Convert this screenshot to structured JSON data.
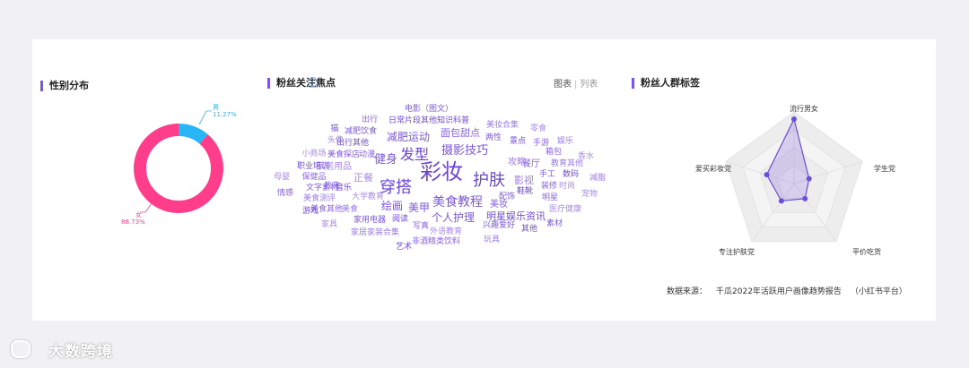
{
  "watermark": {
    "text": "大数跨境"
  },
  "sections": {
    "gender": "性别分布",
    "focus": "粉丝关注焦点",
    "tags": "粉丝人群标签"
  },
  "tabs": {
    "graph": "图表",
    "list": "列表"
  },
  "source": {
    "label": "数据来源：",
    "report": "千瓜2022年活跃用户画像趋势报告",
    "platform": "（小红书平台）"
  },
  "colors": {
    "male": "#29b6f6",
    "female": "#ff3d8b",
    "accent": "#7b55ea",
    "radar": "#6a4fd8"
  },
  "chart_data": [
    {
      "type": "pie",
      "title": "性别分布",
      "slices": [
        {
          "name": "男",
          "value": 11.27,
          "label": "11.27%"
        },
        {
          "name": "女",
          "value": 88.73,
          "label": "88.73%"
        }
      ]
    },
    {
      "type": "wordcloud",
      "title": "粉丝关注焦点",
      "words": [
        "彩妆",
        "护肤",
        "穿搭",
        "发型",
        "美食教程",
        "摄影技巧",
        "减肥运动",
        "健身",
        "美甲",
        "个人护理",
        "绘画",
        "面包甜点",
        "影视",
        "正餐",
        "美妆",
        "明星娱乐资讯",
        "餐厅",
        "攻略",
        "家居用品",
        "电影（图文）",
        "日常片段其他知识科普",
        "出行",
        "美妆合集",
        "零食",
        "两性",
        "景点",
        "手游",
        "娱乐",
        "香水",
        "减肥饮食",
        "出行其他",
        "动漫",
        "头像",
        "小商场",
        "美食探店",
        "职业培训",
        "保健品",
        "教育",
        "母婴",
        "文字素材",
        "音乐",
        "情感",
        "美食测评",
        "大学教育",
        "配饰",
        "游戏",
        "美食其他",
        "美食",
        "家具",
        "家用电器",
        "阅读",
        "写真",
        "家居家装合集",
        "外语教育",
        "兴趣爱好",
        "艺术",
        "非酒精类饮料",
        "玩具",
        "医疗健康",
        "素材",
        "其他",
        "明星",
        "减脂",
        "宠物",
        "手工",
        "数码",
        "箱包",
        "教育其他",
        "时尚",
        "猫",
        "鞋靴",
        "装修"
      ]
    },
    {
      "type": "radar",
      "title": "粉丝人群标签",
      "categories": [
        "流行男女",
        "学生党",
        "平价吃货",
        "专注护肤党",
        "爱买彩妆党"
      ],
      "values": [
        90,
        22,
        26,
        30,
        40
      ],
      "rmax": 100
    }
  ]
}
